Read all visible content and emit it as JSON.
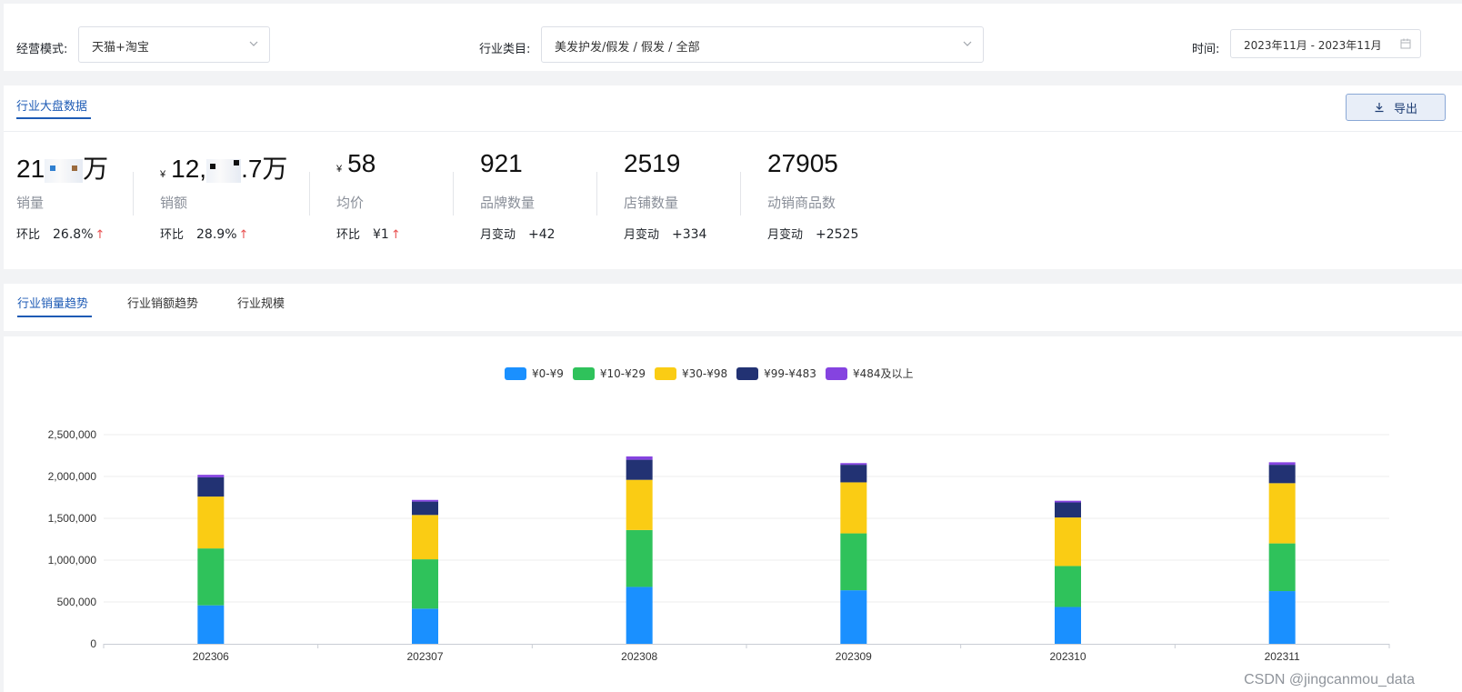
{
  "filters": {
    "mode_label": "经营模式:",
    "mode_value": "天猫+淘宝",
    "category_label": "行业类目:",
    "category_value": "美发护发/假发 / 假发 / 全部",
    "time_label": "时间:",
    "time_value": "2023年11月 - 2023年11月"
  },
  "stats_panel": {
    "tab": "行业大盘数据",
    "export_label": "导出",
    "metrics": [
      {
        "value": "21",
        "value_suffix": "万",
        "name": "销量",
        "compare_label": "环比",
        "compare_value": "26.8%",
        "trend": "up"
      },
      {
        "currency": "¥",
        "value": "12,",
        "value_suffix": ".7万",
        "name": "销额",
        "compare_label": "环比",
        "compare_value": "28.9%",
        "trend": "up"
      },
      {
        "currency": "¥",
        "value": "58",
        "name": "均价",
        "compare_label": "环比",
        "compare_value": "¥1",
        "trend": "up"
      },
      {
        "value": "921",
        "name": "品牌数量",
        "compare_label": "月变动",
        "compare_value": "+42"
      },
      {
        "value": "2519",
        "name": "店铺数量",
        "compare_label": "月变动",
        "compare_value": "+334"
      },
      {
        "value": "27905",
        "name": "动销商品数",
        "compare_label": "月变动",
        "compare_value": "+2525"
      }
    ]
  },
  "chart_tabs": [
    {
      "label": "行业销量趋势",
      "active": true
    },
    {
      "label": "行业销额趋势",
      "active": false
    },
    {
      "label": "行业规模",
      "active": false
    }
  ],
  "colors": {
    "accent": "#1e5bb5",
    "up": "#e84f4f",
    "series": [
      "#1a90ff",
      "#2fc25b",
      "#facc14",
      "#223273",
      "#8543e0"
    ]
  },
  "chart_data": {
    "type": "bar",
    "stacked": true,
    "categories": [
      "202306",
      "202307",
      "202308",
      "202309",
      "202310",
      "202311"
    ],
    "series": [
      {
        "name": "¥0-¥9",
        "values": [
          460000,
          420000,
          680000,
          640000,
          440000,
          630000
        ]
      },
      {
        "name": "¥10-¥29",
        "values": [
          680000,
          590000,
          680000,
          680000,
          490000,
          570000
        ]
      },
      {
        "name": "¥30-¥98",
        "values": [
          620000,
          530000,
          600000,
          610000,
          580000,
          720000
        ]
      },
      {
        "name": "¥99-¥483",
        "values": [
          230000,
          160000,
          240000,
          210000,
          180000,
          220000
        ]
      },
      {
        "name": "¥484及以上",
        "values": [
          30000,
          20000,
          40000,
          20000,
          20000,
          30000
        ]
      }
    ],
    "ylim": [
      0,
      2500000
    ],
    "yticks": [
      "0",
      "500,000",
      "1,000,000",
      "1,500,000",
      "2,000,000",
      "2,500,000"
    ],
    "legend_position": "top-center",
    "grid": true
  },
  "watermark": "CSDN @jingcanmou_data"
}
